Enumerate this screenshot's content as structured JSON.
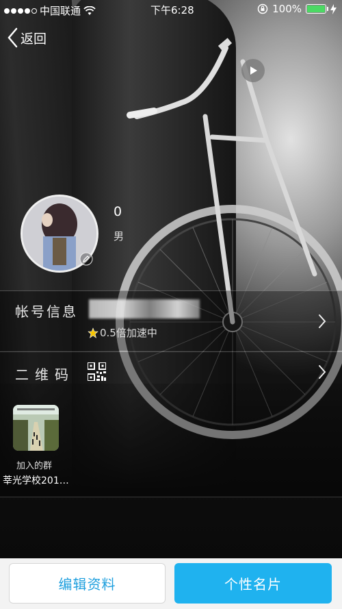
{
  "status_bar": {
    "carrier": "中国联通",
    "time": "下午6:28",
    "battery": "100%",
    "battery_level": 1.0,
    "signal_bars_filled": 4,
    "icons": [
      "signal-dots",
      "wifi-icon",
      "rotation-lock-icon",
      "battery-icon",
      "charging-bolt-icon"
    ]
  },
  "nav": {
    "back_label": "返回",
    "icons": [
      "chevron-left-icon",
      "play-icon"
    ]
  },
  "profile": {
    "nickname": "0",
    "gender": "男"
  },
  "account_row": {
    "label": "帐号信息",
    "account_value_blurred": "",
    "accel_text": "0.5倍加速中",
    "icons": [
      "star-icon",
      "chevron-right-icon"
    ]
  },
  "qr_row": {
    "label": "二维码",
    "icons": [
      "qr-code-icon",
      "chevron-right-icon"
    ]
  },
  "group": {
    "label": "加入的群",
    "name": "莘光学校201…"
  },
  "buttons": {
    "edit": "编辑资料",
    "card": "个性名片"
  },
  "colors": {
    "accent_blue": "#1fb2ef",
    "edit_text": "#1e9fde",
    "battery_green": "#4cd964"
  }
}
